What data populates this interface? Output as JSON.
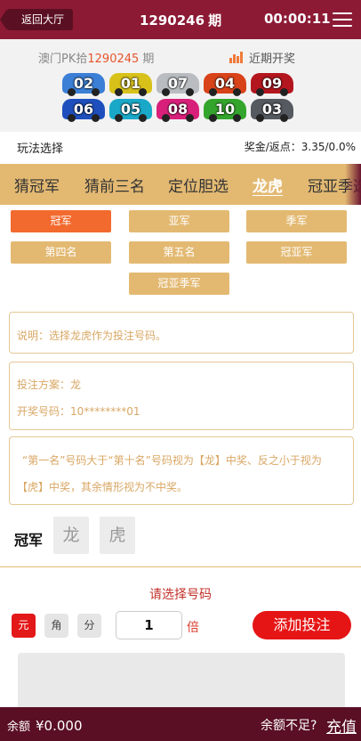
{
  "header": {
    "back_label": "返回大厅",
    "period_number": "1290246",
    "period_suffix": "期",
    "countdown": "00:00:11"
  },
  "results": {
    "game_name": "澳门PK拾",
    "last_period": "1290245",
    "period_suffix": "期",
    "recent_label": "近期开奖",
    "numbers": [
      {
        "value": "02",
        "color": "#3b7fd6"
      },
      {
        "value": "01",
        "color": "#d8c21a"
      },
      {
        "value": "07",
        "color": "#b9bcc0"
      },
      {
        "value": "04",
        "color": "#d8431a"
      },
      {
        "value": "09",
        "color": "#b3161e"
      },
      {
        "value": "06",
        "color": "#1e4fbd"
      },
      {
        "value": "05",
        "color": "#19a8c8"
      },
      {
        "value": "08",
        "color": "#d8207a"
      },
      {
        "value": "10",
        "color": "#34a52c"
      },
      {
        "value": "03",
        "color": "#555a60"
      }
    ]
  },
  "play": {
    "select_label": "玩法选择",
    "odds_label": "奖金/返点：",
    "odds_value": "3.35/0.0%"
  },
  "tabs": [
    {
      "label": "猜冠军",
      "active": false
    },
    {
      "label": "猜前三名",
      "active": false
    },
    {
      "label": "定位胆选",
      "active": false
    },
    {
      "label": "龙虎",
      "active": true
    },
    {
      "label": "冠亚季选",
      "active": false
    }
  ],
  "positions": [
    {
      "label": "冠军",
      "active": true
    },
    {
      "label": "亚军",
      "active": false
    },
    {
      "label": "季军",
      "active": false
    },
    {
      "label": "第四名",
      "active": false
    },
    {
      "label": "第五名",
      "active": false
    },
    {
      "label": "冠亚军",
      "active": false
    },
    {
      "label": "冠亚季军",
      "active": false
    }
  ],
  "info": {
    "description": "说明：选择龙虎作为投注号码。",
    "plan": "投注方案：龙",
    "draw_numbers": "开奖号码：10********01",
    "rule_line1": "“第一名”号码大于“第十名”号码视为【龙】中奖、反之小于视为",
    "rule_line2": "【虎】中奖，其余情形视为不中奖。"
  },
  "dragon_tiger": {
    "position_label": "冠军",
    "dragon": "龙",
    "tiger": "虎"
  },
  "betting": {
    "hint": "请选择号码",
    "units": [
      {
        "label": "元",
        "active": true
      },
      {
        "label": "角",
        "active": false
      },
      {
        "label": "分",
        "active": false
      }
    ],
    "multiplier": "1",
    "multiplier_unit": "倍",
    "add_label": "添加投注"
  },
  "footer": {
    "balance_label": "余额",
    "balance_value": "¥0.000",
    "short_label": "余额不足?",
    "recharge_label": "充值"
  },
  "colors": {
    "header_bg": "#8c1a35",
    "accent_gold": "#e3b972",
    "active_orange": "#f26a2e",
    "action_red": "#e61515"
  }
}
